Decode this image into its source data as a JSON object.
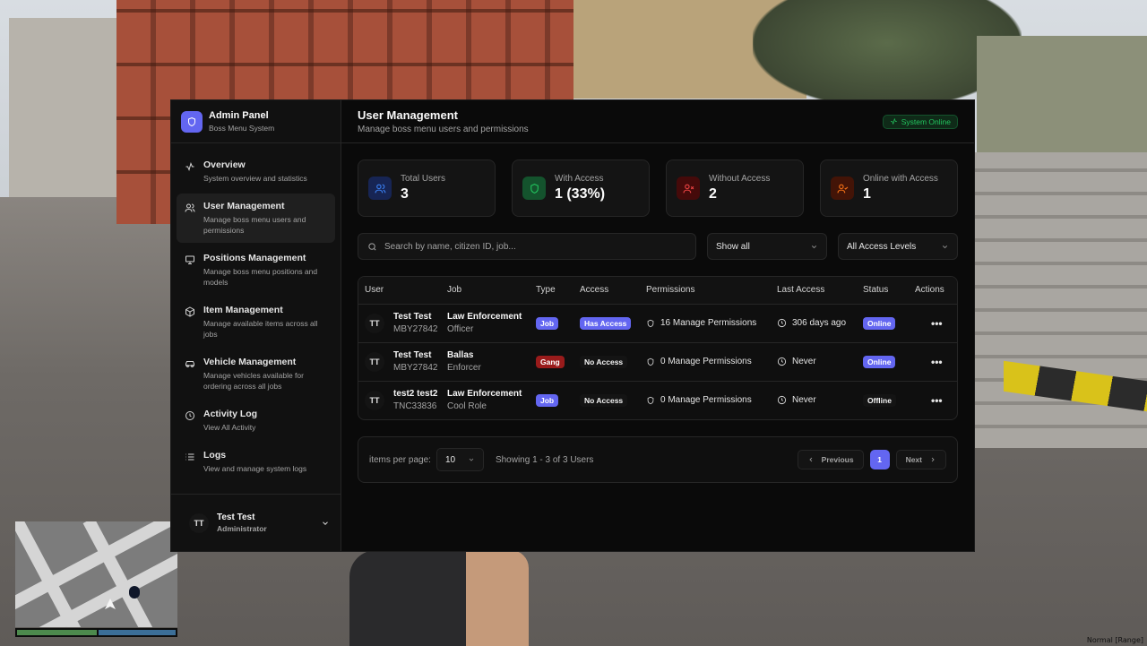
{
  "brand": {
    "title": "Admin Panel",
    "subtitle": "Boss Menu System"
  },
  "nav": [
    {
      "label": "Overview",
      "desc": "System overview and statistics",
      "icon": "activity-icon"
    },
    {
      "label": "User Management",
      "desc": "Manage boss menu users and permissions",
      "icon": "users-icon",
      "active": true
    },
    {
      "label": "Positions Management",
      "desc": "Manage boss menu positions and models",
      "icon": "monitor-icon"
    },
    {
      "label": "Item Management",
      "desc": "Manage available items across all jobs",
      "icon": "box-icon"
    },
    {
      "label": "Vehicle Management",
      "desc": "Manage vehicles available for ordering across all jobs",
      "icon": "car-icon"
    },
    {
      "label": "Activity Log",
      "desc": "View All Activity",
      "icon": "clock-icon"
    },
    {
      "label": "Logs",
      "desc": "View and manage system logs",
      "icon": "list-icon"
    }
  ],
  "current_user": {
    "initials": "TT",
    "name": "Test Test",
    "role": "Administrator"
  },
  "header": {
    "title": "User Management",
    "subtitle": "Manage boss menu users and permissions",
    "status": "System Online"
  },
  "stats": [
    {
      "label": "Total Users",
      "value": "3",
      "color": "#3b82f6",
      "bg": "#172554"
    },
    {
      "label": "With Access",
      "value": "1 (33%)",
      "color": "#22c55e",
      "bg": "#14532d"
    },
    {
      "label": "Without Access",
      "value": "2",
      "color": "#ef4444",
      "bg": "#450a0a"
    },
    {
      "label": "Online with Access",
      "value": "1",
      "color": "#f97316",
      "bg": "#431407"
    }
  ],
  "filters": {
    "search_placeholder": "Search by name, citizen ID, job...",
    "type_filter": "Show all",
    "access_filter": "All Access Levels"
  },
  "table": {
    "columns": [
      "User",
      "Job",
      "Type",
      "Access",
      "Permissions",
      "Last Access",
      "Status",
      "Actions"
    ],
    "rows": [
      {
        "initials": "TT",
        "name": "Test Test",
        "cid": "MBY27842",
        "job": "Law Enforcement",
        "grade": "Officer",
        "type": "Job",
        "access": "Has Access",
        "permissions": "16 Manage Permissions",
        "last_access": "306 days ago",
        "status": "Online"
      },
      {
        "initials": "TT",
        "name": "Test Test",
        "cid": "MBY27842",
        "job": "Ballas",
        "grade": "Enforcer",
        "type": "Gang",
        "access": "No Access",
        "permissions": "0 Manage Permissions",
        "last_access": "Never",
        "status": "Online"
      },
      {
        "initials": "TT",
        "name": "test2 test2",
        "cid": "TNC33836",
        "job": "Law Enforcement",
        "grade": "Cool Role",
        "type": "Job",
        "access": "No Access",
        "permissions": "0 Manage Permissions",
        "last_access": "Never",
        "status": "Offline"
      }
    ]
  },
  "pagination": {
    "per_page_label": "items per page:",
    "per_page": "10",
    "showing": "Showing 1 - 3 of 3 Users",
    "previous": "Previous",
    "current": "1",
    "next": "Next"
  },
  "accent_color": "#6366f1",
  "hud": {
    "voice_label": "Normal [Range]"
  }
}
